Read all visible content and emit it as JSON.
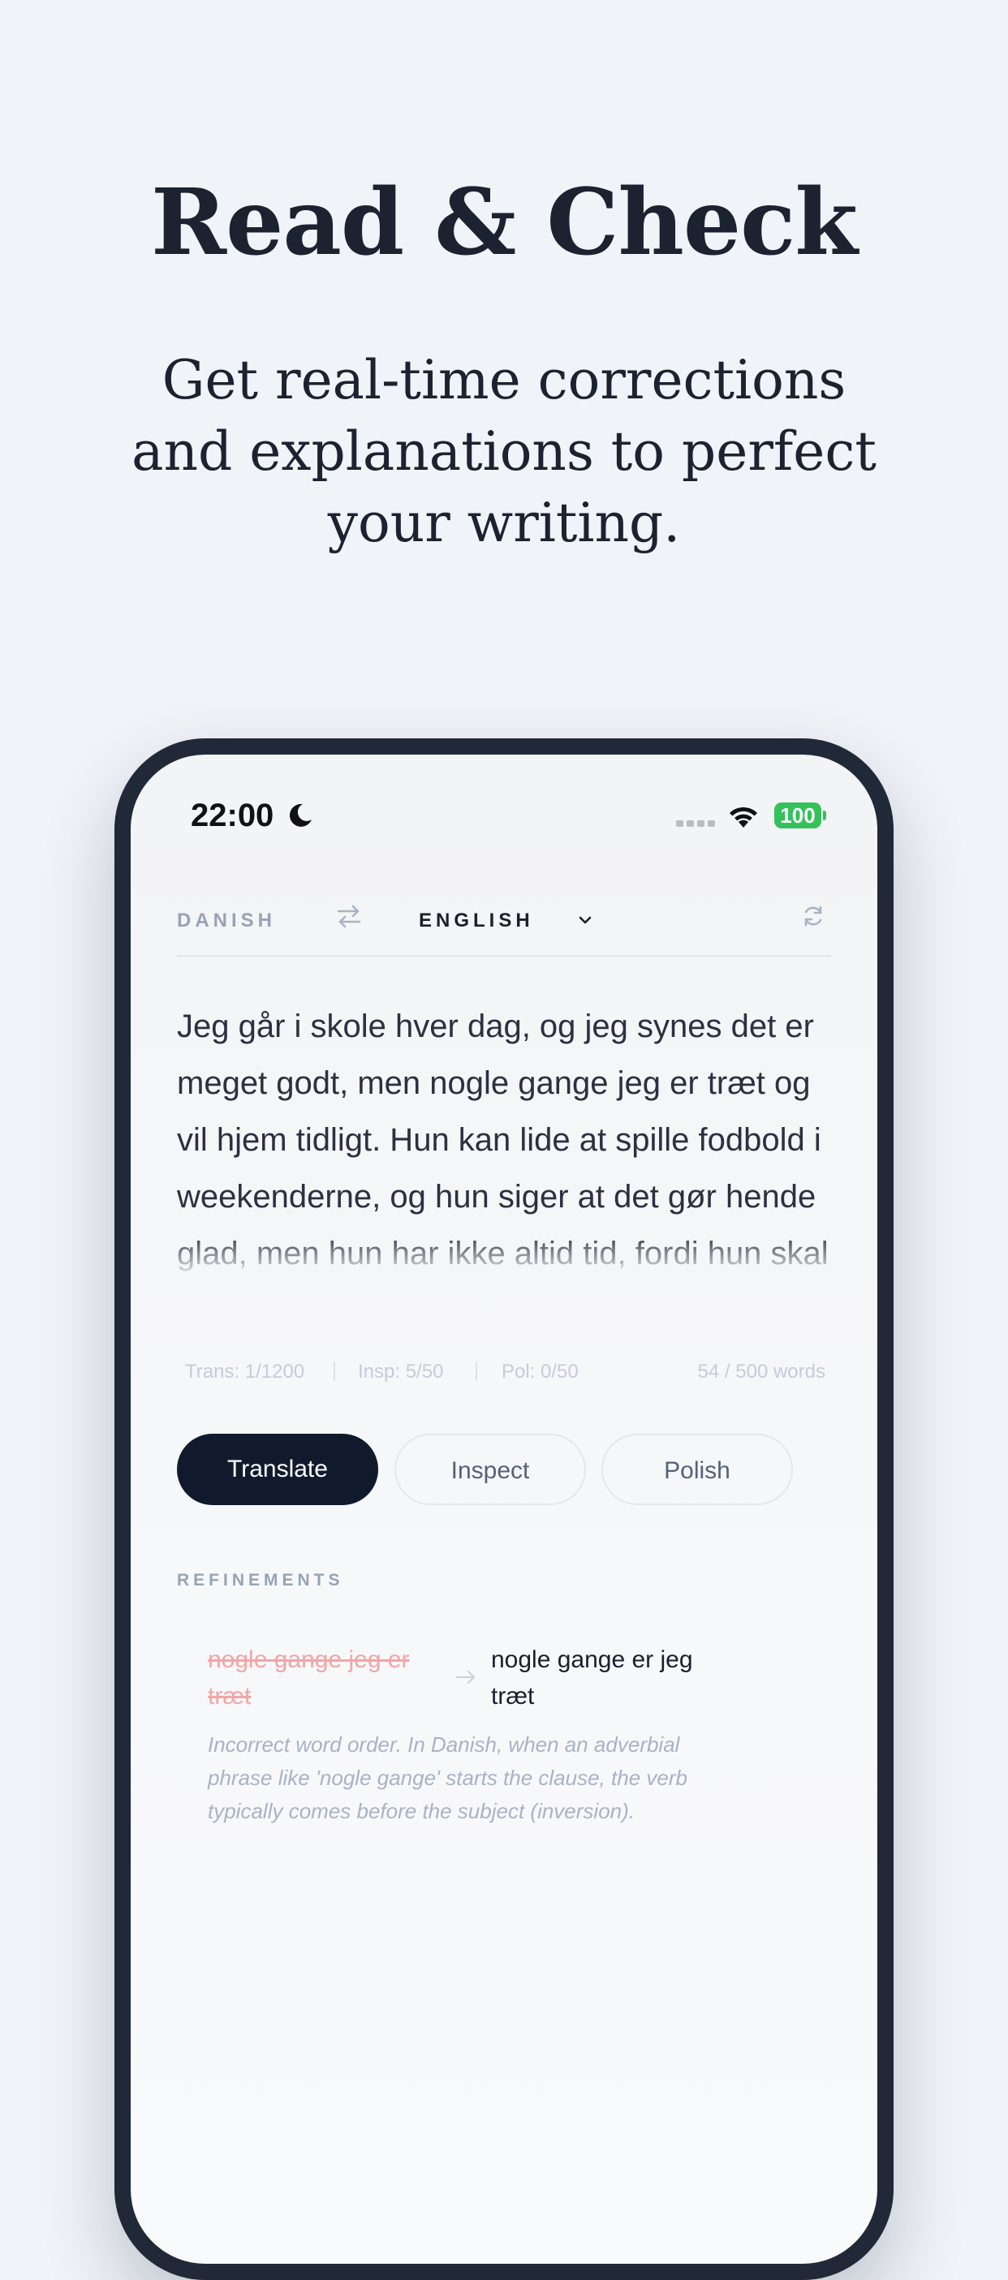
{
  "hero": {
    "title": "Read & Check",
    "subtitle": "Get real-time corrections and explanations to perfect your writing."
  },
  "status_bar": {
    "time": "22:00",
    "battery": "100",
    "icons": [
      "moon-icon",
      "signal-icon",
      "wifi-icon",
      "battery-icon"
    ]
  },
  "language_bar": {
    "source": "DANISH",
    "target": "ENGLISH",
    "icons": [
      "swap-icon",
      "chevron-down-icon",
      "refresh-icon"
    ]
  },
  "input": {
    "text": "Jeg går i skole hver dag, og jeg synes det er meget godt, men nogle gange jeg er træt og vil hjem tidligt. Hun kan lide at spille fodbold i weekenderne, og hun siger at det gør hende glad, men hun har ikke altid tid, fordi hun skal lave lektier og"
  },
  "usage": {
    "trans": "Trans: 1/1200",
    "insp": "Insp: 5/50",
    "pol": "Pol: 0/50",
    "words": "54 / 500 words"
  },
  "actions": {
    "translate": "Translate",
    "inspect": "Inspect",
    "polish": "Polish",
    "active": "translate"
  },
  "refinements": {
    "heading": "REFINEMENTS",
    "items": [
      {
        "original": "nogle gange jeg er træt",
        "corrected": "nogle gange er jeg træt",
        "explanation": "Incorrect word order. In Danish, when an adverbial phrase like 'nogle gange' starts the clause, the verb typically comes before the subject (inversion)."
      }
    ]
  },
  "colors": {
    "background": "#f0f3f8",
    "phone_frame": "#212938",
    "primary_button": "#111a2d",
    "strikethrough": "#f4a5a5",
    "battery": "#35c15a"
  }
}
